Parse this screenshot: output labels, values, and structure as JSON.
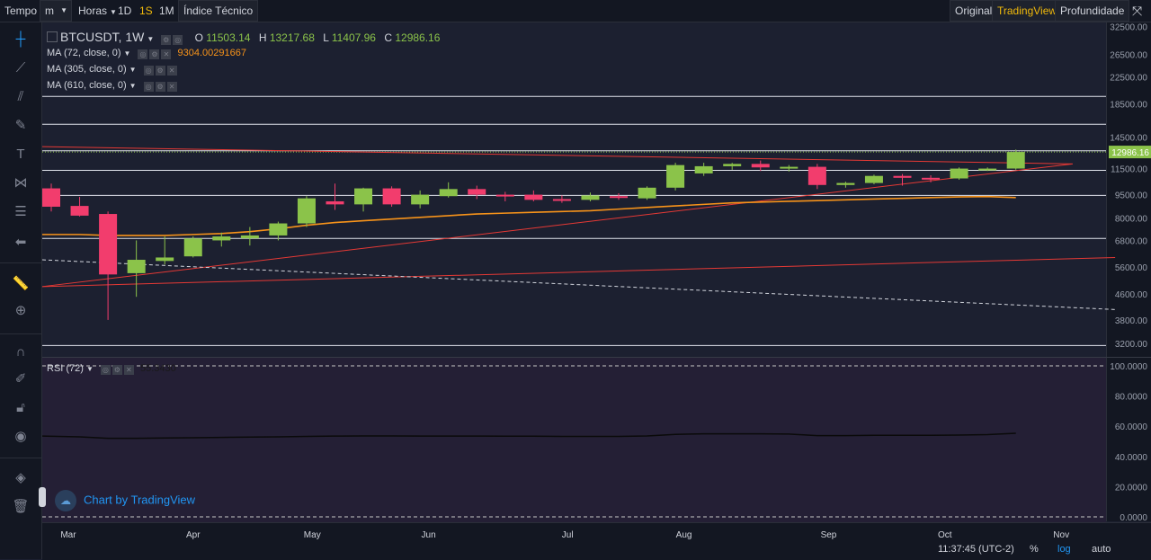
{
  "toolbar": {
    "time_label": "Tempo",
    "interval_value": "m",
    "hours_label": "Horas",
    "btn_1d": "1D",
    "btn_1s": "1S",
    "btn_1m": "1M",
    "indicator_label": "Índice Técnico",
    "view_original": "Original",
    "view_tradingview": "TradingView",
    "view_depth": "Profundidade"
  },
  "legend": {
    "symbol": "BTCUSDT, 1W",
    "o_label": "O",
    "o_value": "11503.14",
    "h_label": "H",
    "h_value": "13217.68",
    "l_label": "L",
    "l_value": "11407.96",
    "c_label": "C",
    "c_value": "12986.16",
    "ma1": "MA (72, close, 0)",
    "ma1_value": "9304.00291667",
    "ma2": "MA (305, close, 0)",
    "ma3": "MA (610, close, 0)",
    "rsi": "RSI (72)",
    "rsi_value": "55.3430"
  },
  "watermark": "Chart by TradingView",
  "footer": {
    "time": "11:37:45 (UTC-2)",
    "percent": "%",
    "log": "log",
    "auto": "auto"
  },
  "colors": {
    "up": "#8bc34a",
    "down": "#f23d6d",
    "ma": "#f7931a",
    "trend": "#e53935",
    "accent": "#f0b90b"
  },
  "chart_data": {
    "type": "candlestick",
    "scale": "log",
    "ylim": [
      2900,
      33500
    ],
    "price_ticks": [
      "32500.00",
      "26500.00",
      "22500.00",
      "18500.00",
      "14500.00",
      "11500.00",
      "9500.00",
      "8000.00",
      "6800.00",
      "5600.00",
      "4600.00",
      "3800.00",
      "3200.00"
    ],
    "last_price": "12986.16",
    "x_labels": [
      "Mar",
      "Apr",
      "May",
      "Jun",
      "Jul",
      "Aug",
      "Sep",
      "Oct",
      "Nov"
    ],
    "x_label_week": [
      0.6,
      5,
      9.2,
      13.3,
      18.2,
      22.3,
      27.4,
      31.5,
      35.6
    ],
    "candles": [
      {
        "o": 9950,
        "h": 10300,
        "l": 8400,
        "c": 8700
      },
      {
        "o": 8750,
        "h": 9350,
        "l": 8100,
        "c": 8150
      },
      {
        "o": 8250,
        "h": 8400,
        "l": 3800,
        "c": 5300
      },
      {
        "o": 5350,
        "h": 6800,
        "l": 4500,
        "c": 5900
      },
      {
        "o": 5850,
        "h": 7000,
        "l": 5700,
        "c": 6000
      },
      {
        "o": 6050,
        "h": 7000,
        "l": 6000,
        "c": 6900
      },
      {
        "o": 6800,
        "h": 7200,
        "l": 6500,
        "c": 7000
      },
      {
        "o": 6900,
        "h": 7500,
        "l": 6550,
        "c": 7050
      },
      {
        "o": 7050,
        "h": 7800,
        "l": 6800,
        "c": 7700
      },
      {
        "o": 7700,
        "h": 9400,
        "l": 7500,
        "c": 9250
      },
      {
        "o": 9050,
        "h": 10300,
        "l": 8500,
        "c": 8850
      },
      {
        "o": 8850,
        "h": 10000,
        "l": 8400,
        "c": 9950
      },
      {
        "o": 9950,
        "h": 10100,
        "l": 8700,
        "c": 8850
      },
      {
        "o": 8850,
        "h": 9800,
        "l": 8600,
        "c": 9500
      },
      {
        "o": 9400,
        "h": 10400,
        "l": 9300,
        "c": 9900
      },
      {
        "o": 9900,
        "h": 10150,
        "l": 9200,
        "c": 9500
      },
      {
        "o": 9500,
        "h": 9700,
        "l": 9050,
        "c": 9400
      },
      {
        "o": 9500,
        "h": 9800,
        "l": 9050,
        "c": 9150
      },
      {
        "o": 9200,
        "h": 9450,
        "l": 8950,
        "c": 9150
      },
      {
        "o": 9150,
        "h": 9650,
        "l": 9050,
        "c": 9450
      },
      {
        "o": 9400,
        "h": 9600,
        "l": 9150,
        "c": 9300
      },
      {
        "o": 9250,
        "h": 10100,
        "l": 9150,
        "c": 10000
      },
      {
        "o": 10000,
        "h": 12000,
        "l": 9800,
        "c": 11800
      },
      {
        "o": 11100,
        "h": 12000,
        "l": 10900,
        "c": 11700
      },
      {
        "o": 11700,
        "h": 12000,
        "l": 11400,
        "c": 11900
      },
      {
        "o": 11900,
        "h": 12200,
        "l": 11300,
        "c": 11600
      },
      {
        "o": 11550,
        "h": 11800,
        "l": 11250,
        "c": 11650
      },
      {
        "o": 11650,
        "h": 11900,
        "l": 9900,
        "c": 10200
      },
      {
        "o": 10200,
        "h": 10450,
        "l": 10000,
        "c": 10350
      },
      {
        "o": 10350,
        "h": 11000,
        "l": 10250,
        "c": 10900
      },
      {
        "o": 10900,
        "h": 11050,
        "l": 10150,
        "c": 10750
      },
      {
        "o": 10750,
        "h": 10950,
        "l": 10400,
        "c": 10700
      },
      {
        "o": 10700,
        "h": 11600,
        "l": 10600,
        "c": 11500
      },
      {
        "o": 11350,
        "h": 11600,
        "l": 11300,
        "c": 11500
      },
      {
        "o": 11503.14,
        "h": 13217.68,
        "l": 11407.96,
        "c": 12986.16
      }
    ],
    "ma72": [
      7100,
      7100,
      7050,
      7050,
      7050,
      7100,
      7150,
      7250,
      7400,
      7600,
      7750,
      7850,
      7950,
      8050,
      8150,
      8250,
      8300,
      8350,
      8400,
      8450,
      8550,
      8650,
      8750,
      8850,
      8950,
      9000,
      9050,
      9100,
      9150,
      9200,
      9250,
      9300,
      9350,
      9370,
      9304
    ],
    "horizontal_levels": [
      19500,
      15900,
      13100,
      11350,
      9450,
      6900,
      3150
    ],
    "trend_lines": [
      {
        "w1": 0,
        "p1": 13500,
        "w2": 36,
        "p2": 11900,
        "color": "#e53935"
      },
      {
        "w1": 0,
        "p1": 4850,
        "w2": 36,
        "p2": 11900,
        "color": "#e53935"
      },
      {
        "w1": 0,
        "p1": 4850,
        "w2": 37.5,
        "p2": 6000,
        "color": "#e53935"
      },
      {
        "w1": 0,
        "p1": 5900,
        "w2": 37.5,
        "p2": 4100,
        "color": "#d1d4dc",
        "dashed": true
      }
    ],
    "rsi": {
      "ylim": [
        0,
        100
      ],
      "ticks": [
        "100.0000",
        "80.0000",
        "60.0000",
        "40.0000",
        "20.0000",
        "0.0000"
      ],
      "values": [
        53.5,
        53,
        52,
        52,
        52.2,
        52.4,
        52.6,
        52.8,
        53,
        53.3,
        53.5,
        53.6,
        53.6,
        53.5,
        53.5,
        53.5,
        53.4,
        53.4,
        53.3,
        53.3,
        53.3,
        53.6,
        54.6,
        55,
        55,
        55,
        54.8,
        53.8,
        53.8,
        54,
        54,
        54,
        54.2,
        54.5,
        55.343
      ]
    }
  }
}
